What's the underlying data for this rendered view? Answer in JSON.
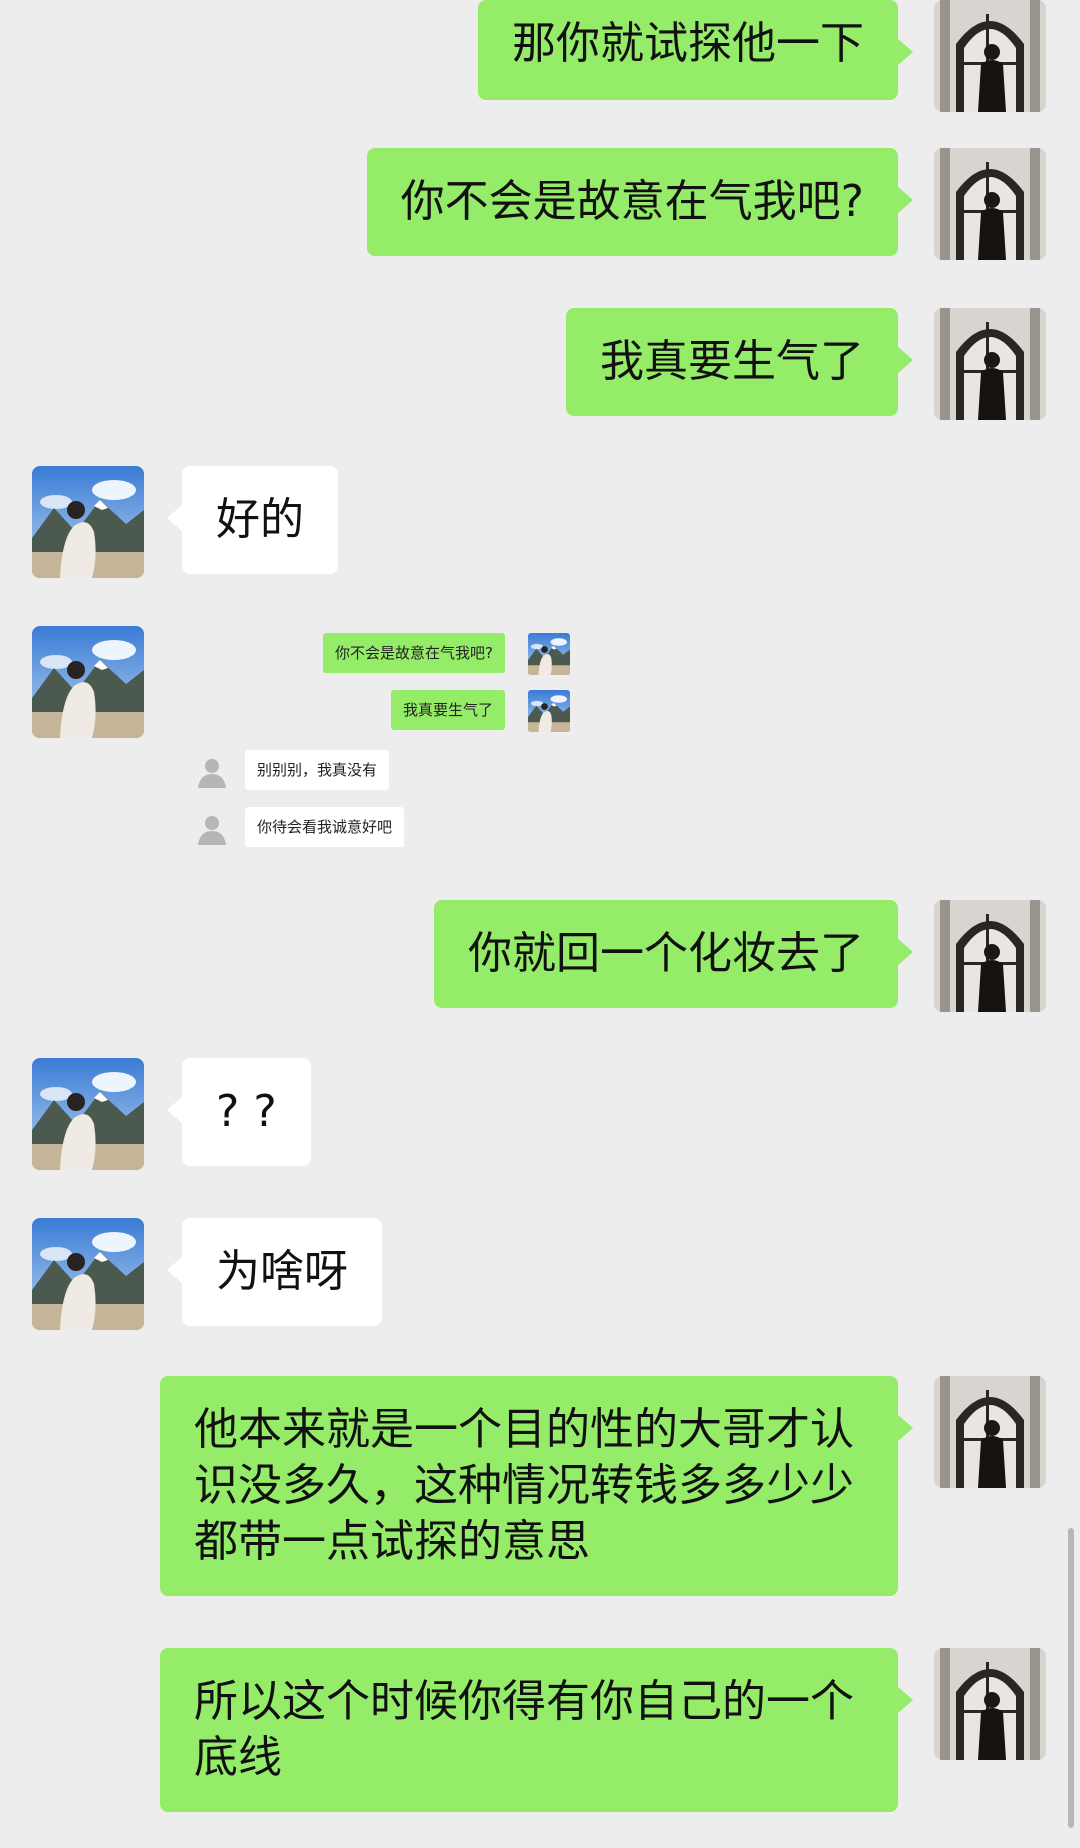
{
  "messages": [
    {
      "side": "out",
      "text": "那你就试探他一下"
    },
    {
      "side": "out",
      "text": "你不会是故意在气我吧?"
    },
    {
      "side": "out",
      "text": "我真要生气了"
    },
    {
      "side": "in",
      "text": "好的"
    },
    {
      "side": "in",
      "embedded_screenshot": true
    },
    {
      "side": "out",
      "text": "你就回一个化妆去了"
    },
    {
      "side": "in",
      "text": "? ?"
    },
    {
      "side": "in",
      "text": "为啥呀"
    },
    {
      "side": "out",
      "text": "他本来就是一个目的性的大哥才认识没多久，这种情况转钱多多少少都带一点试探的意思"
    },
    {
      "side": "out",
      "text": "所以这个时候你得有你自己的一个底线"
    }
  ],
  "embedded": {
    "messages": [
      {
        "side": "out",
        "text": "你不会是故意在气我吧?"
      },
      {
        "side": "out",
        "text": "我真要生气了"
      },
      {
        "side": "in",
        "text": "别别别，我真没有"
      },
      {
        "side": "in",
        "text": "你待会看我诚意好吧"
      }
    ]
  },
  "colors": {
    "background": "#ededed",
    "outgoing_bubble": "#95ec69",
    "incoming_bubble": "#ffffff"
  },
  "icons": {
    "my_avatar": "man-in-gothic-doorway-avatar",
    "contact_avatar": "woman-mountain-landscape-avatar",
    "placeholder_avatar": "person-silhouette-icon"
  }
}
